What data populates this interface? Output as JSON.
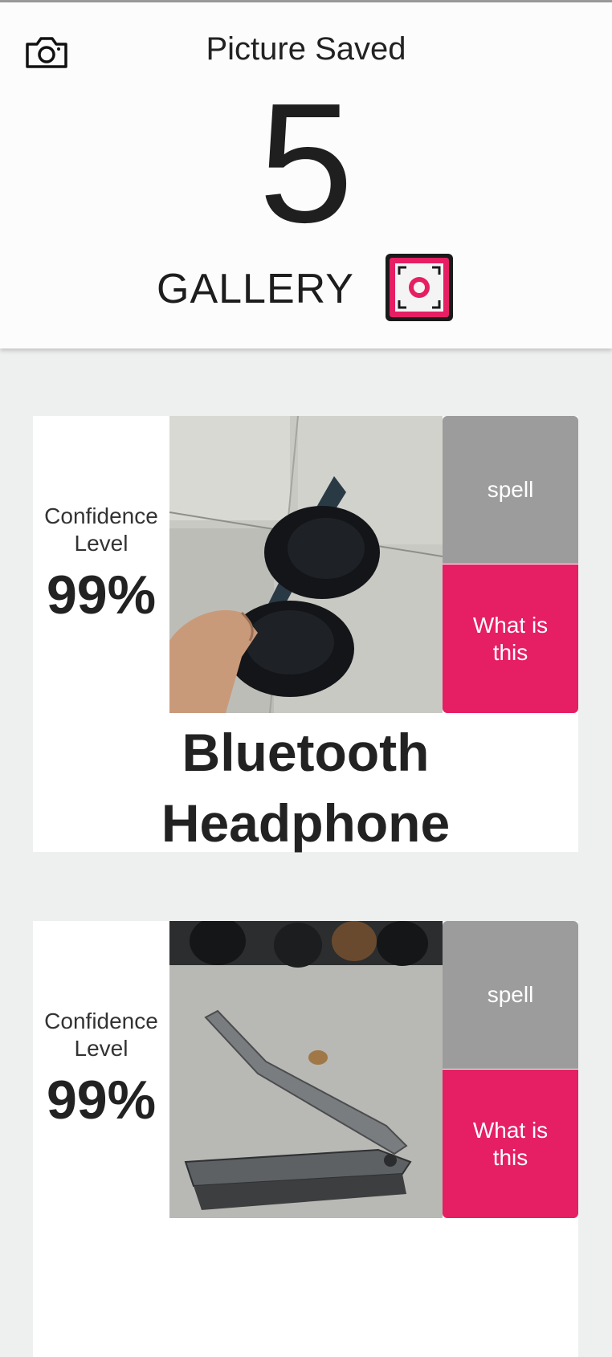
{
  "header": {
    "title": "Picture Saved",
    "count": "5",
    "gallery_label": "GALLERY",
    "camera_icon": "camera-icon",
    "gallery_icon": "focus-camera-icon",
    "accent_color": "#e61e63"
  },
  "cards": [
    {
      "confidence_label": "Confidence Level",
      "confidence_value": "99%",
      "spell_label": "spell",
      "what_label": "What is this",
      "name": "Bluetooth Headphone",
      "image": "photo of black bluetooth headphones held in hand"
    },
    {
      "confidence_label": "Confidence Level",
      "confidence_value": "99%",
      "spell_label": "spell",
      "what_label": "What is this",
      "name": "",
      "image": "photo of a nail clipper on a table"
    }
  ],
  "colors": {
    "spell_button": "#9c9c9c",
    "what_button": "#e61e63",
    "background": "#eef0ef"
  }
}
